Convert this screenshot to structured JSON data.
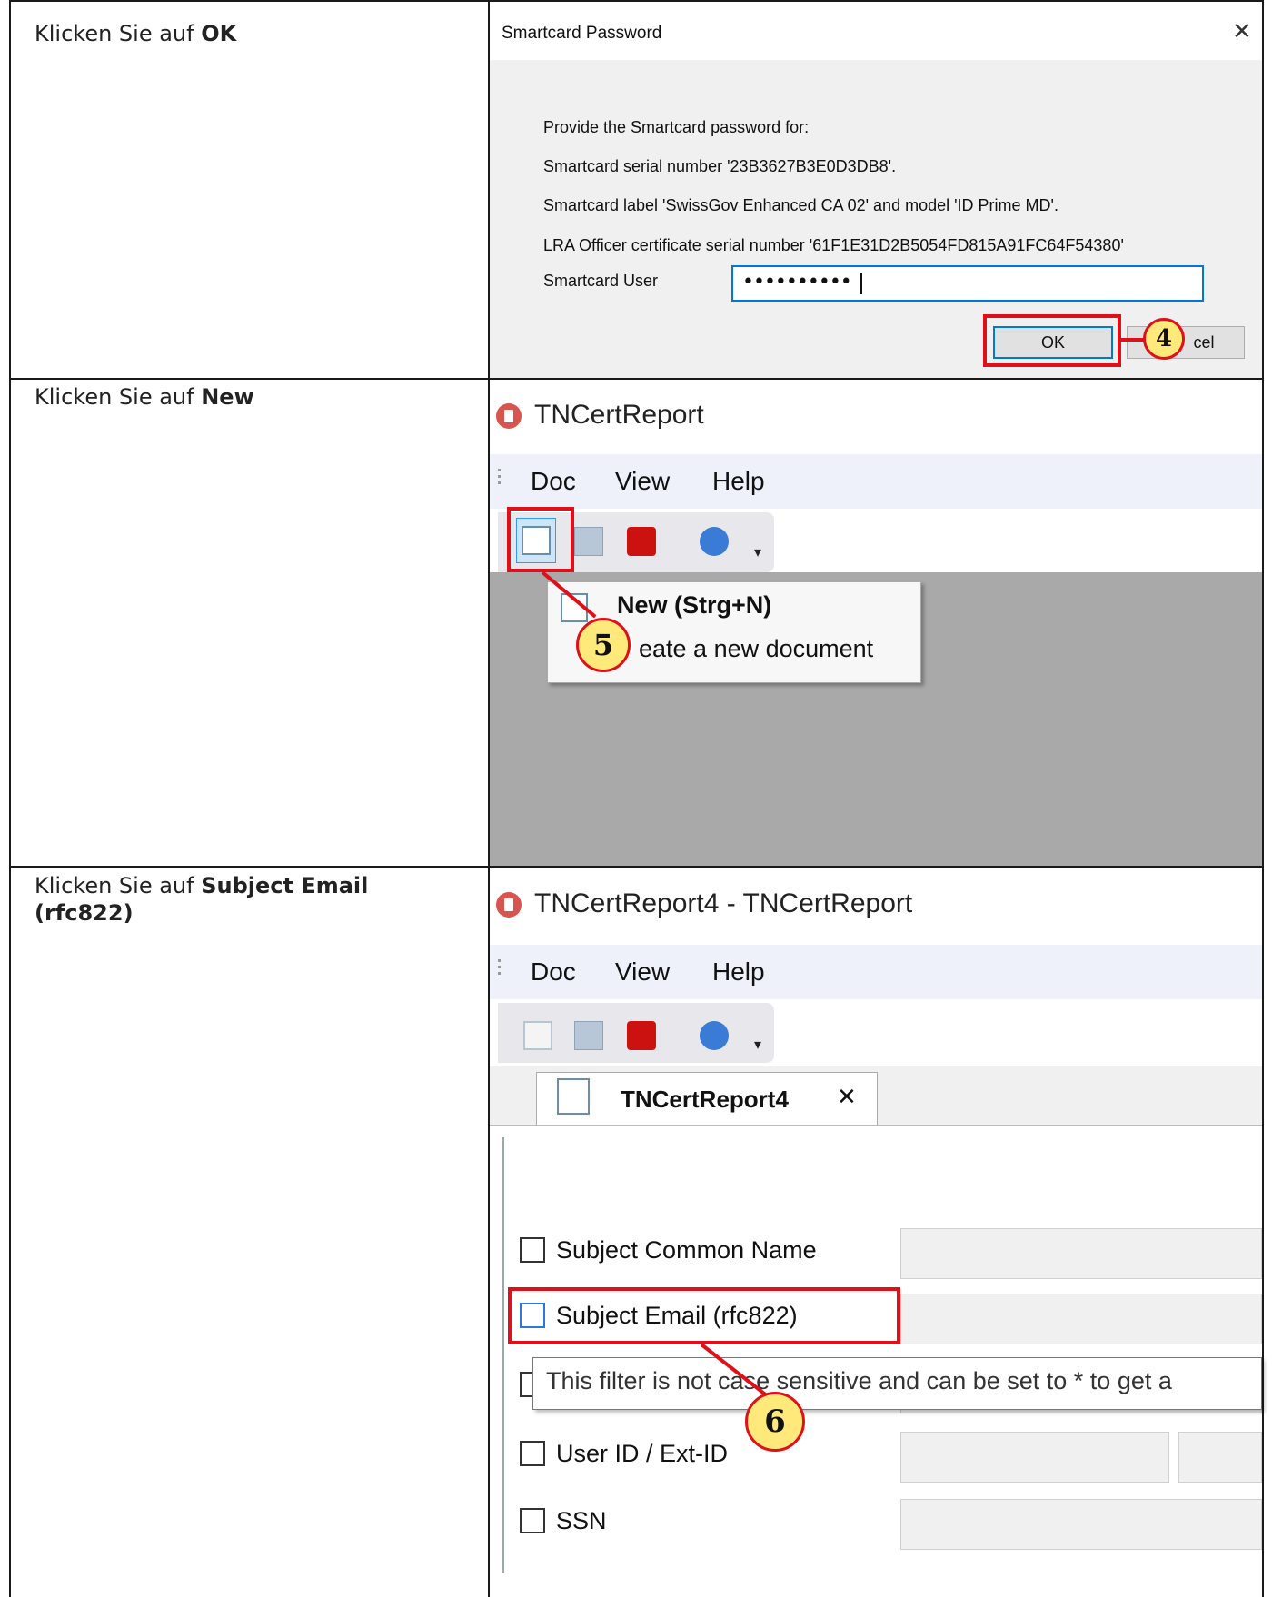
{
  "steps": [
    {
      "prefix": "Klicken Sie auf ",
      "bold": "OK"
    },
    {
      "prefix": "Klicken Sie auf ",
      "bold": "New"
    },
    {
      "prefix": "Klicken Sie auf ",
      "bold": "Subject Email (rfc822)"
    }
  ],
  "dialog": {
    "title": "Smartcard Password",
    "line1": "Provide the Smartcard password for:",
    "line2": "Smartcard serial number '23B3627B3E0D3DB8'.",
    "line3": "Smartcard label 'SwissGov Enhanced CA 02'  and model 'ID Prime MD'.",
    "line4": "LRA Officer certificate serial number '61F1E31D2B5054FD815A91FC64F54380'",
    "field_label": "Smartcard User",
    "password_value": "••••••••••",
    "ok_label": "OK",
    "cancel_label_visible": "cel",
    "callout": "4"
  },
  "app1": {
    "title": "TNCertReport",
    "menu": [
      "Doc",
      "View",
      "Help"
    ],
    "tooltip_title": "New (Strg+N)",
    "tooltip_desc": "eate a new document",
    "callout": "5"
  },
  "app2": {
    "title": "TNCertReport4 - TNCertReport",
    "menu": [
      "Doc",
      "View",
      "Help"
    ],
    "tab_label": "TNCertReport4",
    "tab_close": "✕",
    "filters": [
      "Subject Common Name",
      "Subject Email (rfc822)",
      "User ID / Ext-ID",
      "SSN"
    ],
    "tooltip": "This filter is not case sensitive and can be set to * to get a",
    "callout": "6"
  },
  "colors": {
    "highlight": "#e0101a",
    "callout_fill": "#ffe97a",
    "menubar": "#eef0fa",
    "app_gray": "#a9a9a9"
  }
}
